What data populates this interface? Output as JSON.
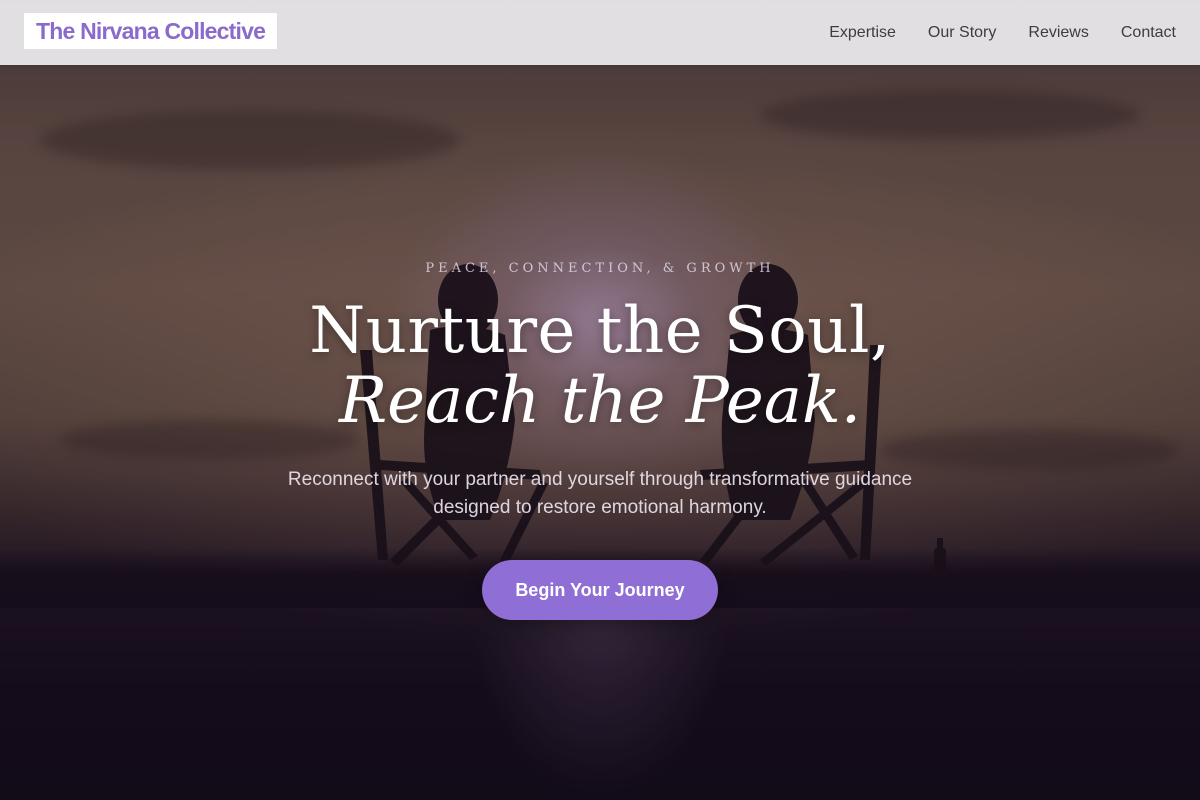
{
  "brand": {
    "name": "The Nirvana Collective",
    "color": "#8a6acb"
  },
  "nav": {
    "links": [
      {
        "label": "Expertise"
      },
      {
        "label": "Our Story"
      },
      {
        "label": "Reviews"
      },
      {
        "label": "Contact"
      }
    ]
  },
  "hero": {
    "eyebrow": "PEACE, CONNECTION, & GROWTH",
    "headline_line1": "Nurture the Soul,",
    "headline_line2": "Reach the Peak.",
    "subtext": "Reconnect with your partner and yourself through transformative guidance designed to restore emotional harmony.",
    "cta_label": "Begin Your Journey",
    "accent_color": "#8f6fd6",
    "background_image": "sunset-couple-in-camping-chairs"
  }
}
